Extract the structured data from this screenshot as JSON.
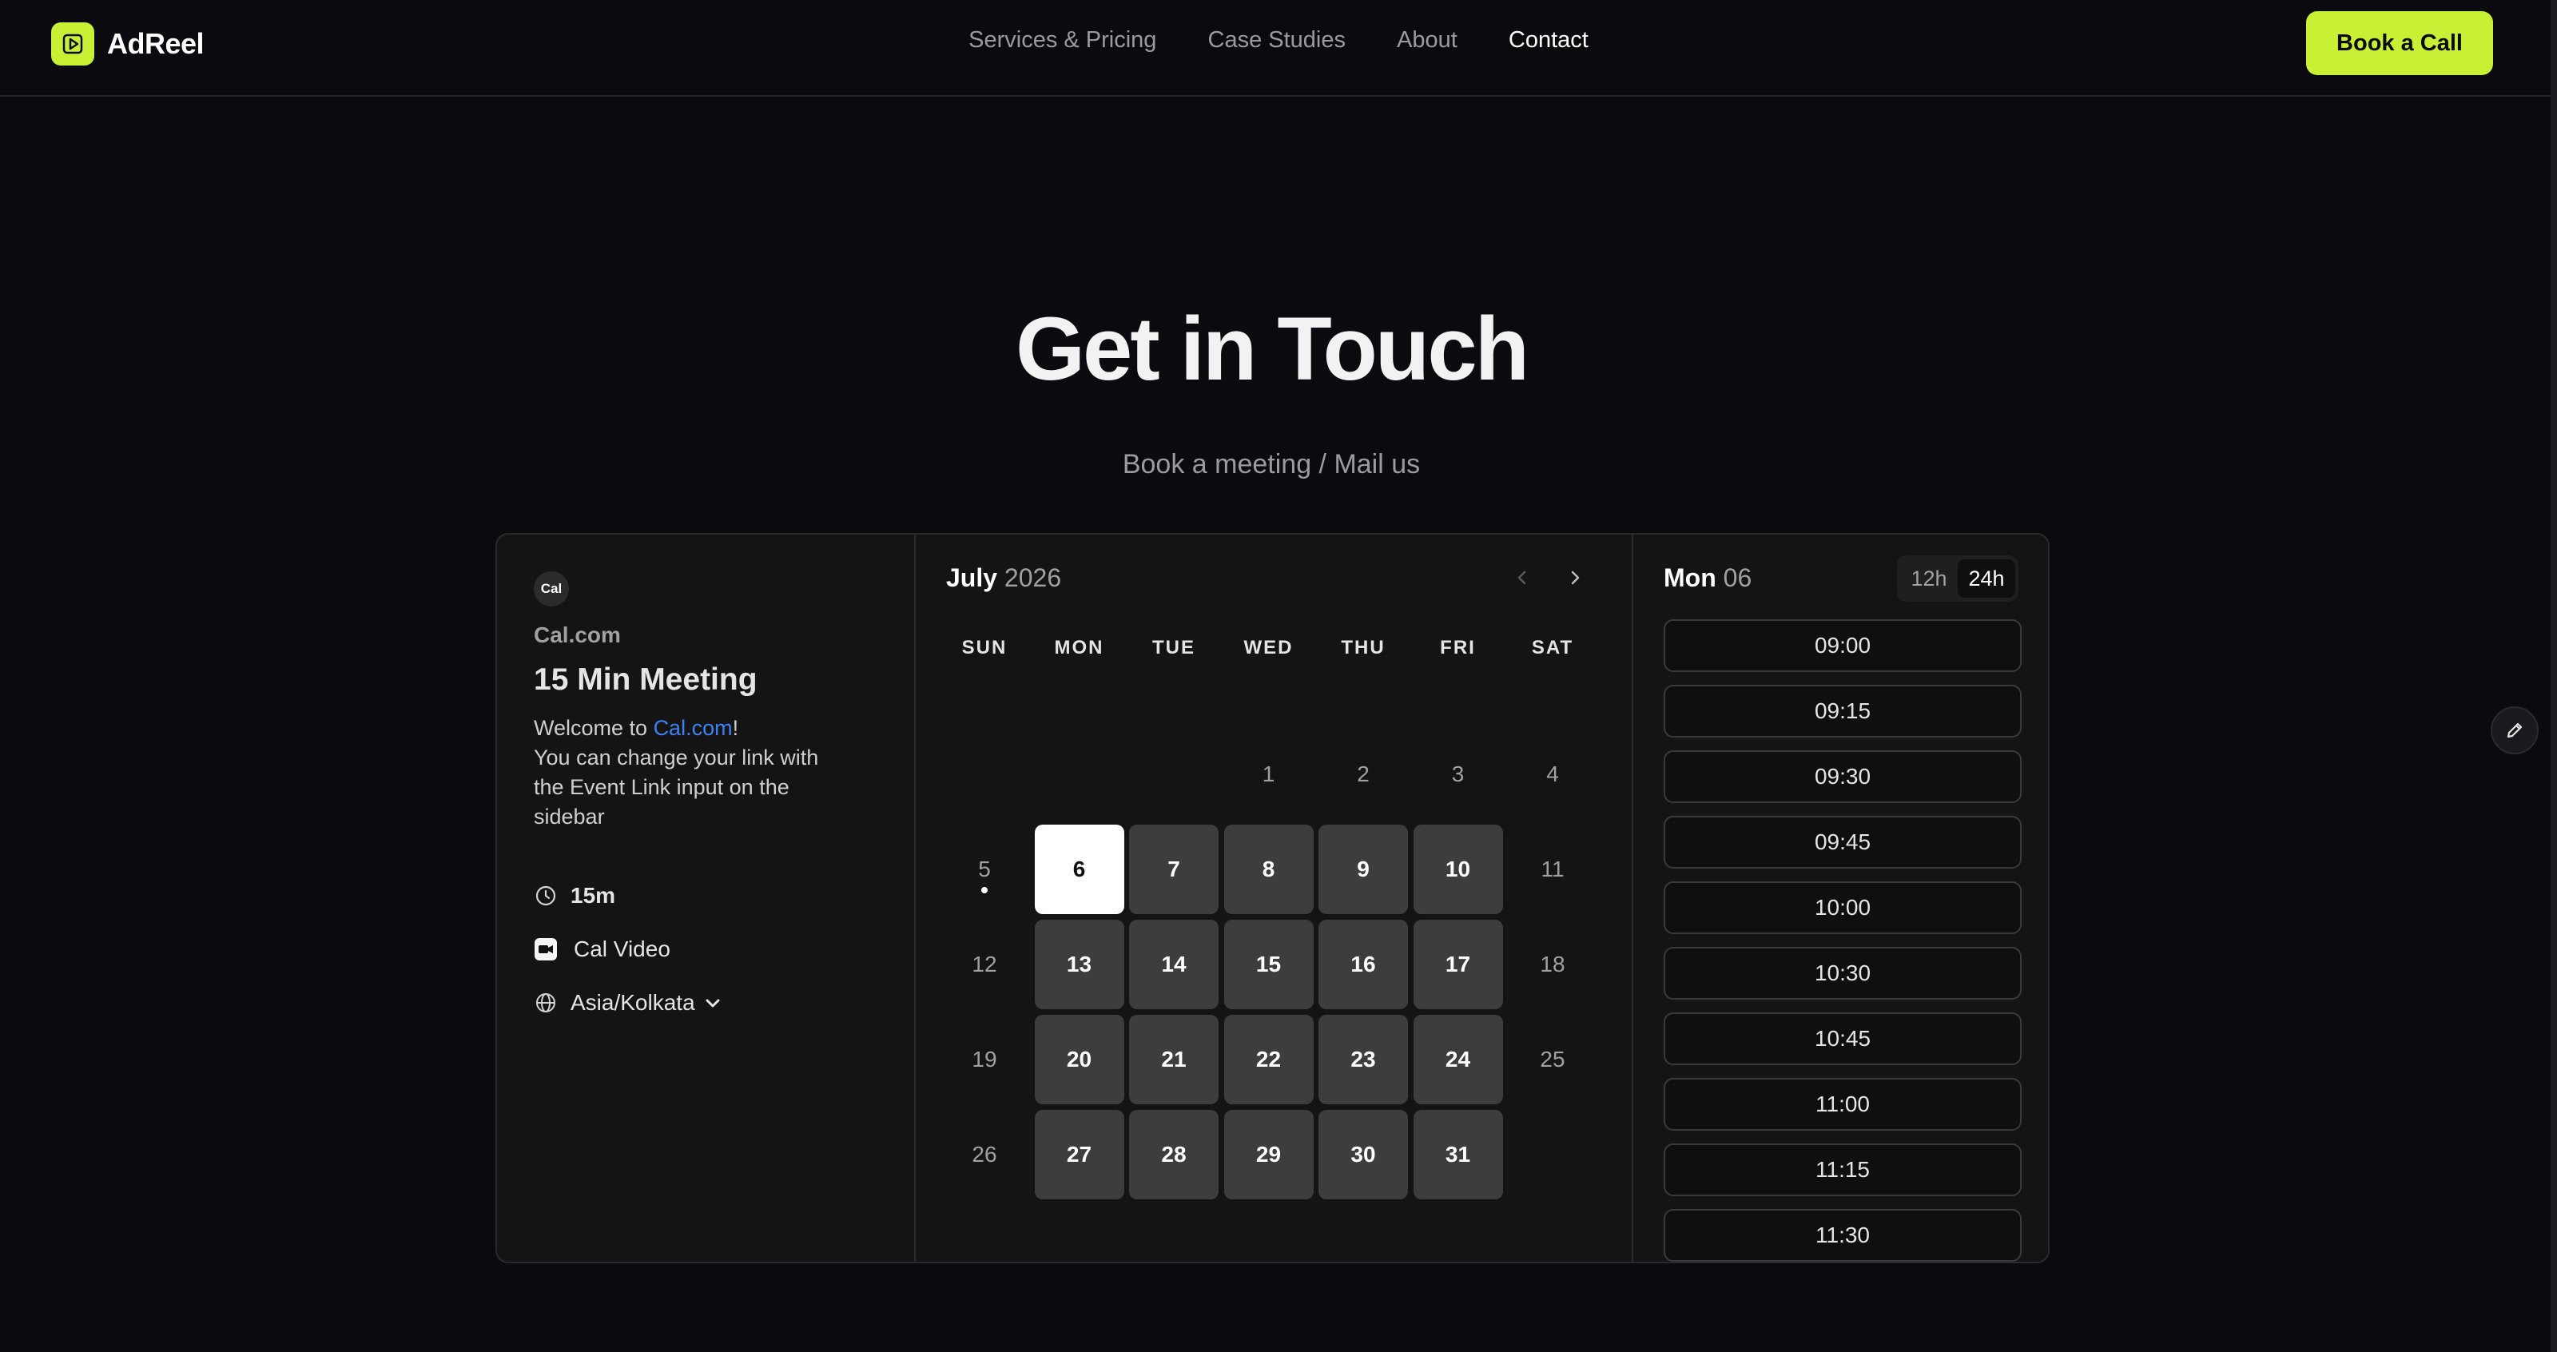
{
  "nav": {
    "brand": "AdReel",
    "links": [
      "Services & Pricing",
      "Case Studies",
      "About",
      "Contact"
    ],
    "active_link": "Contact",
    "cta_label": "Book a Call"
  },
  "hero": {
    "title": "Get in Touch",
    "subtitle": "Book a meeting / Mail us"
  },
  "booker": {
    "avatar_text": "Cal",
    "org": "Cal.com",
    "event_title": "15 Min Meeting",
    "description": {
      "prefix": "Welcome to ",
      "link": "Cal.com",
      "suffix": "!",
      "line2": "You can change your link with the Event Link input on the sidebar"
    },
    "duration": "15m",
    "location": "Cal Video",
    "timezone": "Asia/Kolkata",
    "calendar": {
      "month": "July",
      "year": "2026",
      "weekdays": [
        "SUN",
        "MON",
        "TUE",
        "WED",
        "THU",
        "FRI",
        "SAT"
      ],
      "weeks": [
        [
          null,
          null,
          null,
          "1",
          "2",
          "3",
          "4"
        ],
        [
          "5",
          "6",
          "7",
          "8",
          "9",
          "10",
          "11"
        ],
        [
          "12",
          "13",
          "14",
          "15",
          "16",
          "17",
          "18"
        ],
        [
          "19",
          "20",
          "21",
          "22",
          "23",
          "24",
          "25"
        ],
        [
          "26",
          "27",
          "28",
          "29",
          "30",
          "31",
          null
        ]
      ],
      "available_days": [
        "7",
        "8",
        "9",
        "10",
        "13",
        "14",
        "15",
        "16",
        "17",
        "20",
        "21",
        "22",
        "23",
        "24",
        "27",
        "28",
        "29",
        "30",
        "31"
      ],
      "selected_day": "6",
      "today": "5"
    },
    "slots_panel": {
      "day_label": "Mon",
      "day_num": "06",
      "format_12h": "12h",
      "format_24h": "24h",
      "active_format": "24h",
      "times": [
        "09:00",
        "09:15",
        "09:30",
        "09:45",
        "10:00",
        "10:30",
        "10:45",
        "11:00",
        "11:15",
        "11:30"
      ]
    }
  },
  "colors": {
    "background": "#0b0b0f",
    "accent": "#c8f135",
    "link": "#3b82f6",
    "panel": "#141414"
  }
}
